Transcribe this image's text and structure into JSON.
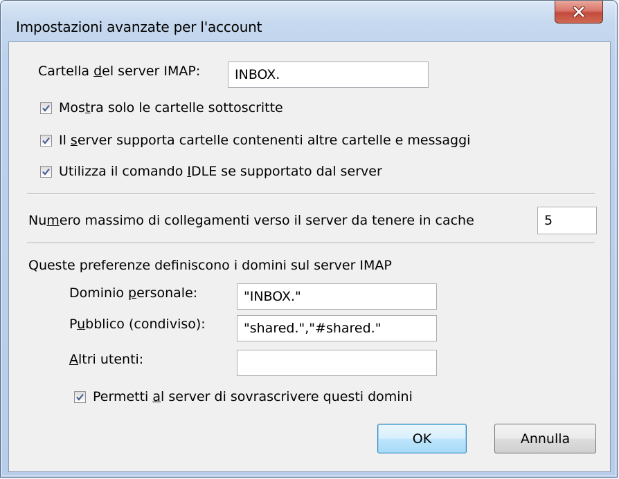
{
  "window": {
    "title": "Impostazioni avanzate per l'account"
  },
  "imap_folder": {
    "label_before": "Cartella ",
    "label_mnemonic": "d",
    "label_after": "el server IMAP:",
    "value": "INBOX."
  },
  "options": [
    {
      "before": "Mostra solo le cartelle sotto",
      "mnemonic": "",
      "after": "",
      "full_before": "Mos",
      "full_mnemonic": "t",
      "full_after": "ra solo le cartelle sottoscritte",
      "checked": true
    },
    {
      "full_before": "Il ",
      "full_mnemonic": "s",
      "full_after": "erver supporta cartelle contenenti altre cartelle e messaggi",
      "checked": true
    },
    {
      "full_before": "Utilizza il comando ",
      "full_mnemonic": "I",
      "full_after": "DLE se supportato dal server",
      "checked": true
    }
  ],
  "cache": {
    "label_before": "Nu",
    "label_mnemonic": "m",
    "label_after": "ero massimo di collegamenti verso il server da tenere in cache",
    "value": "5"
  },
  "namespaces": {
    "heading": "Queste preferenze definiscono i domini sul server IMAP",
    "personal": {
      "label_before": "Dominio ",
      "label_mnemonic": "p",
      "label_after": "ersonale:",
      "value": "\"INBOX.\""
    },
    "public": {
      "label_before": "P",
      "label_mnemonic": "u",
      "label_after": "bblico (condiviso):",
      "value": "\"shared.\",\"#shared.\""
    },
    "other": {
      "label_before": "",
      "label_mnemonic": "A",
      "label_after": "ltri utenti:",
      "value": ""
    },
    "override": {
      "before": "Permetti ",
      "mnemonic": "a",
      "after": "l server di sovrascrivere questi domini",
      "checked": true
    }
  },
  "buttons": {
    "ok": "OK",
    "cancel": "Annulla"
  },
  "colors": {
    "client_bg": "#f0f0f0",
    "frame": "#b7cde9",
    "close_button": "#c44b3d",
    "default_button": "#bee6fd"
  },
  "icons": {
    "close": "close-x-icon",
    "check": "checkmark-icon"
  }
}
